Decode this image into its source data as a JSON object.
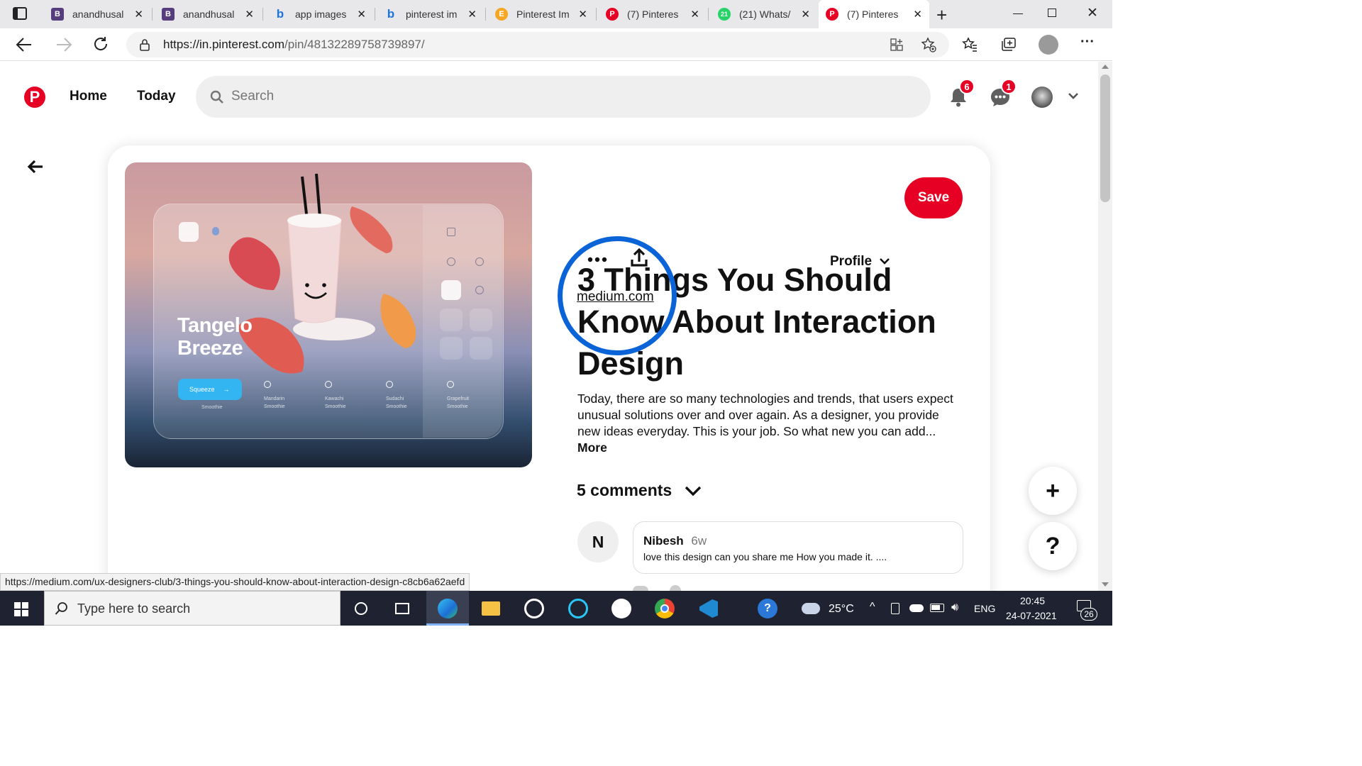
{
  "browser": {
    "tabs": [
      {
        "title": "anandhusal",
        "favicon": "bootstrap-icon",
        "color": "#563d7c"
      },
      {
        "title": "anandhusal",
        "favicon": "bootstrap-icon",
        "color": "#563d7c"
      },
      {
        "title": "app images",
        "favicon": "bing-icon",
        "color": "#1a73e8"
      },
      {
        "title": "pinterest im",
        "favicon": "bing-icon",
        "color": "#1a73e8"
      },
      {
        "title": "Pinterest Im",
        "favicon": "envato-icon",
        "color": "#f5a623"
      },
      {
        "title": "(7) Pinteres",
        "favicon": "pinterest-icon",
        "color": "#e60023"
      },
      {
        "title": "(21) Whats/",
        "favicon": "whatsapp-icon",
        "color": "#25d366"
      },
      {
        "title": "(7) Pinteres",
        "favicon": "pinterest-icon",
        "color": "#e60023"
      }
    ],
    "url_host": "https://in.pinterest.com",
    "url_path": "/pin/48132289758739897/"
  },
  "header": {
    "home_label": "Home",
    "today_label": "Today",
    "search_placeholder": "Search",
    "notifications_count": "6",
    "messages_count": "1"
  },
  "pin": {
    "image_text": {
      "title_line1": "Tangelo",
      "title_line2": "Breeze",
      "button": "Squeeze",
      "flavors": [
        {
          "name": "Mandarin",
          "sub": "Smoothie"
        },
        {
          "name": "Kawachi",
          "sub": "Smoothie"
        },
        {
          "name": "Sudachi",
          "sub": "Smoothie"
        },
        {
          "name": "Grapefruit",
          "sub": "Smoothie"
        }
      ],
      "first_flavor_sub": "Smoothie"
    },
    "more_icon": "more-horizontal-icon",
    "share_icon": "share-icon",
    "profile_label": "Profile",
    "save_label": "Save",
    "source_link": "medium.com",
    "title": "3 Things You Should Know About Interaction Design",
    "description": "Today, there are so many technologies and trends, that users expect unusual solutions over and over again. As a designer, you provide new ideas everyday. This is your job. So what new you can add...",
    "more_label": "More",
    "comments_label": "5 comments",
    "comment": {
      "avatar_letter": "N",
      "author": "Nibesh",
      "age": "6w",
      "text": "love this design can you share me How you made it. ...."
    },
    "annotation_color": "#0a64d8"
  },
  "status_url": "https://medium.com/ux-designers-club/3-things-you-should-know-about-interaction-design-c8cb6a62aefd",
  "taskbar": {
    "search_placeholder": "Type here to search",
    "temperature": "25°C",
    "language": "ENG",
    "time": "20:45",
    "date": "24-07-2021",
    "notification_count": "26"
  },
  "colors": {
    "pinterest_red": "#e60023"
  }
}
